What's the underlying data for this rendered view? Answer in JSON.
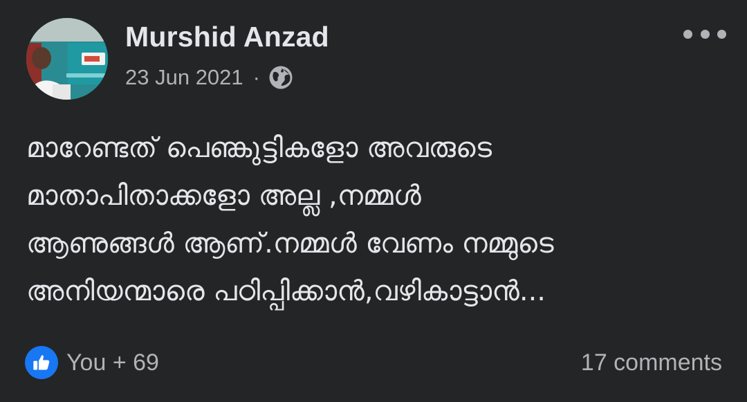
{
  "post": {
    "author": "Murshid Anzad",
    "date": "23 Jun 2021",
    "separator": "·",
    "privacy_icon": "globe-icon",
    "menu_icon": "more-horizontal-icon",
    "text_lines": [
      "മാറേണ്ടത് പെണ്കുട്ടികളോ അവരുടെ",
      "മാതാപിതാക്കളോ അല്ല ,നമ്മൾ",
      "ആണുങ്ങൾ ആണ്.നമ്മൾ വേണം നമ്മുടെ",
      "അനിയന്മാരെ പഠിപ്പിക്കാൻ,വഴികാട്ടാൻ..."
    ],
    "reactions": {
      "icon": "like-icon",
      "label": "You + 69"
    },
    "comments_label": "17 comments"
  },
  "colors": {
    "background": "#242526",
    "primary_text": "#e4e6eb",
    "secondary_text": "#b0b3b8",
    "like_blue": "#1877f2"
  }
}
